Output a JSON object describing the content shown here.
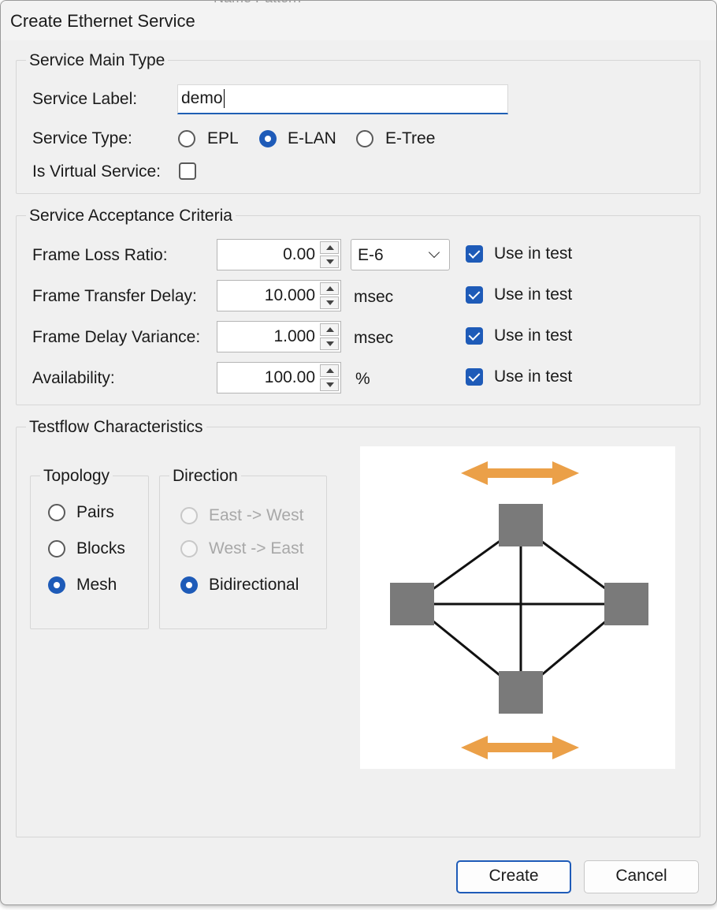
{
  "window": {
    "title": "Create Ethernet Service",
    "background_partial_text": "Name Pattern"
  },
  "main_type": {
    "legend": "Service Main Type",
    "label_caption": "Service Label:",
    "label_value": "demo",
    "type_caption": "Service Type:",
    "types": [
      {
        "label": "EPL",
        "checked": false
      },
      {
        "label": "E-LAN",
        "checked": true
      },
      {
        "label": "E-Tree",
        "checked": false
      }
    ],
    "virtual_caption": "Is Virtual Service:",
    "virtual_checked": false
  },
  "acceptance": {
    "legend": "Service Acceptance Criteria",
    "rows": [
      {
        "label": "Frame Loss Ratio:",
        "value": "0.00",
        "unit": "",
        "use_label": "Use in test",
        "use_checked": true
      },
      {
        "label": "Frame Transfer Delay:",
        "value": "10.000",
        "unit": "msec",
        "use_label": "Use in test",
        "use_checked": true
      },
      {
        "label": "Frame Delay Variance:",
        "value": "1.000",
        "unit": "msec",
        "use_label": "Use in test",
        "use_checked": true
      },
      {
        "label": "Availability:",
        "value": "100.00",
        "unit": "%",
        "use_label": "Use in test",
        "use_checked": true
      }
    ],
    "loss_exponent": "E-6"
  },
  "testflow": {
    "legend": "Testflow Characteristics",
    "topology": {
      "legend": "Topology",
      "options": [
        {
          "label": "Pairs",
          "checked": false
        },
        {
          "label": "Blocks",
          "checked": false
        },
        {
          "label": "Mesh",
          "checked": true
        }
      ]
    },
    "direction": {
      "legend": "Direction",
      "options": [
        {
          "label": "East -> West",
          "checked": false,
          "enabled": false
        },
        {
          "label": "West -> East",
          "checked": false,
          "enabled": false
        },
        {
          "label": "Bidirectional",
          "checked": true,
          "enabled": true
        }
      ]
    },
    "diagram_colors": {
      "node": "#7a7a7a",
      "arrow": "#eba048",
      "line": "#111111"
    }
  },
  "buttons": {
    "create": "Create",
    "cancel": "Cancel"
  }
}
